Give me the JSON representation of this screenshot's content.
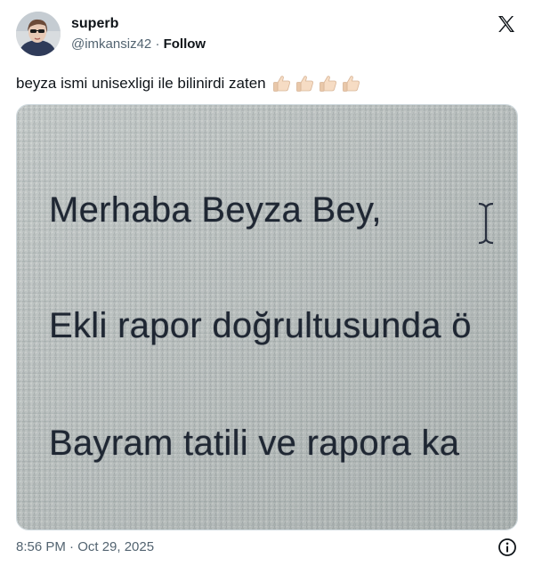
{
  "author": {
    "name": "superb",
    "handle": "@imkansiz42",
    "separator": "·",
    "follow_label": "Follow"
  },
  "tweet": {
    "text": "beyza ismi unisexligi ile bilinirdi zaten",
    "emoji_icons": [
      "thumbs-up-icon",
      "thumbs-up-icon",
      "thumbs-up-icon",
      "thumbs-up-icon"
    ]
  },
  "media": {
    "lines": [
      "Merhaba Beyza Bey,",
      "Ekli rapor doğrultusunda ö",
      "Bayram tatili ve rapora ka"
    ]
  },
  "footer": {
    "timestamp": "8:56 PM · Oct 29, 2025"
  },
  "colors": {
    "text_primary": "#0f1419",
    "text_secondary": "#536471",
    "photo_background": "#b9bfbe",
    "photo_text": "#1f2733"
  },
  "icons": {
    "platform": "x-logo-icon",
    "info": "info-icon",
    "cursor": "text-cursor-icon"
  }
}
